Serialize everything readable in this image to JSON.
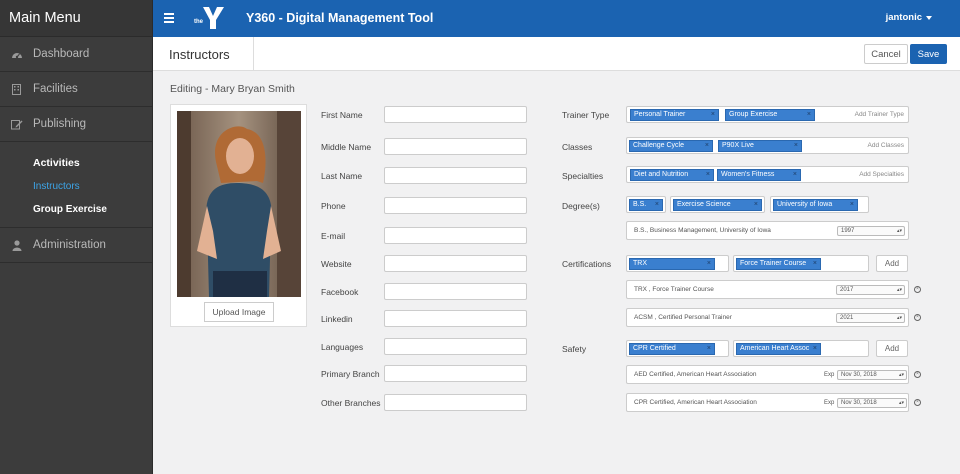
{
  "sidebar": {
    "title": "Main Menu",
    "items": [
      {
        "label": "Dashboard",
        "icon": "dashboard-icon"
      },
      {
        "label": "Facilities",
        "icon": "building-icon"
      },
      {
        "label": "Publishing",
        "icon": "edit-icon"
      },
      {
        "label": "Administration",
        "icon": "user-icon"
      }
    ],
    "publishing_sub": [
      {
        "label": "Activities"
      },
      {
        "label": "Instructors"
      },
      {
        "label": "Group Exercise"
      }
    ]
  },
  "topbar": {
    "logo_text": "the",
    "title": "Y360 - Digital Management Tool",
    "user": "jantonic"
  },
  "header": {
    "title": "Instructors",
    "cancel": "Cancel",
    "save": "Save"
  },
  "editing_label": "Editing - Mary Bryan Smith",
  "upload_label": "Upload Image",
  "left_fields": [
    "First Name",
    "Middle Name",
    "Last Name",
    "Phone",
    "E-mail",
    "Website",
    "Facebook",
    "Linkedin",
    "Languages",
    "Primary Branch",
    "Other Branches"
  ],
  "right": {
    "trainer_type": {
      "label": "Trainer Type",
      "tags": [
        "Personal Trainer",
        "Group Exercise"
      ],
      "add": "Add Trainer Type"
    },
    "classes": {
      "label": "Classes",
      "tags": [
        "Challenge Cycle",
        "P90X Live"
      ],
      "add": "Add Classes"
    },
    "specialties": {
      "label": "Specialties",
      "tags": [
        "Diet and Nutrition",
        "Women's Fitness"
      ],
      "add": "Add Specialties"
    },
    "degrees": {
      "label": "Degree(s)",
      "tags": [
        "B.S.",
        "Exercise Science",
        "University of Iowa"
      ],
      "rows": [
        {
          "text": "B.S., Business Management, University of Iowa",
          "year": "1997"
        }
      ]
    },
    "certifications": {
      "label": "Certifications",
      "tags": [
        "TRX",
        "Force Trainer Course"
      ],
      "add": "Add",
      "rows": [
        {
          "text": "TRX , Force Trainer Course",
          "year": "2017"
        },
        {
          "text": "ACSM , Certified Personal Trainer",
          "year": "2021"
        }
      ]
    },
    "safety": {
      "label": "Safety",
      "tags": [
        "CPR Certified",
        "American Heart Assoc"
      ],
      "add": "Add",
      "exp_label": "Exp",
      "rows": [
        {
          "text": "AED Certified, American Heart Association",
          "date": "Nov 30, 2018"
        },
        {
          "text": "CPR Certified, American Heart Association",
          "date": "Nov 30, 2018"
        }
      ]
    }
  },
  "colors": {
    "brand": "#1b63b1",
    "sidebar": "#3c3c3c",
    "active": "#3da5e8",
    "tag": "#3a7fcf"
  }
}
